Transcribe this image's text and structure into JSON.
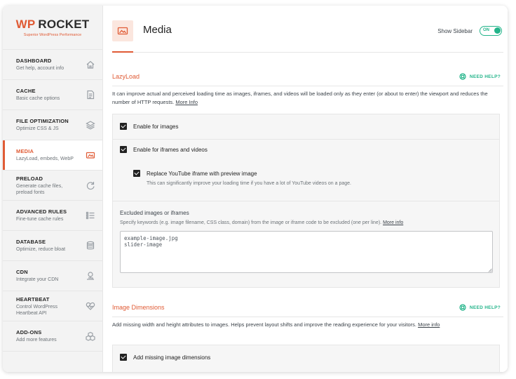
{
  "brand": {
    "wp": "WP",
    "rocket": "ROCKET",
    "tagline": "Superior WordPress Performance"
  },
  "sidebar": {
    "items": [
      {
        "title": "DASHBOARD",
        "sub": "Get help, account info",
        "icon": "home-icon"
      },
      {
        "title": "CACHE",
        "sub": "Basic cache options",
        "icon": "file-icon"
      },
      {
        "title": "FILE OPTIMIZATION",
        "sub": "Optimize CSS & JS",
        "icon": "layers-icon"
      },
      {
        "title": "MEDIA",
        "sub": "LazyLoad, embeds, WebP",
        "icon": "media-icon",
        "active": true
      },
      {
        "title": "PRELOAD",
        "sub": "Generate cache files, preload fonts",
        "icon": "refresh-icon"
      },
      {
        "title": "ADVANCED RULES",
        "sub": "Fine-tune cache rules",
        "icon": "list-icon"
      },
      {
        "title": "DATABASE",
        "sub": "Optimize, reduce bloat",
        "icon": "database-icon"
      },
      {
        "title": "CDN",
        "sub": "Integrate your CDN",
        "icon": "cdn-icon"
      },
      {
        "title": "HEARTBEAT",
        "sub": "Control WordPress Heartbeat API",
        "icon": "heartbeat-icon"
      },
      {
        "title": "ADD-ONS",
        "sub": "Add more features",
        "icon": "addons-icon"
      }
    ]
  },
  "header": {
    "title": "Media",
    "show_sidebar": "Show Sidebar",
    "toggle": "ON"
  },
  "lazyload": {
    "title": "LazyLoad",
    "help": "NEED HELP?",
    "desc": "It can improve actual and perceived loading time as images, iframes, and videos will be loaded only as they enter (or about to enter) the viewport and reduces the number of HTTP requests.",
    "more": "More Info",
    "opt_images": "Enable for images",
    "opt_iframes": "Enable for iframes and videos",
    "opt_youtube": "Replace YouTube iframe with preview image",
    "opt_youtube_desc": "This can significantly improve your loading time if you have a lot of YouTube videos on a page.",
    "excluded_label": "Excluded images or iframes",
    "excluded_desc": "Specify keywords (e.g. image filename, CSS class, domain) from the image or iframe code to be excluded (one per line).",
    "excluded_more": "More info",
    "excluded_value": "example-image.jpg\nslider-image"
  },
  "dimensions": {
    "title": "Image Dimensions",
    "help": "NEED HELP?",
    "desc": "Add missing width and height attributes to images. Helps prevent layout shifts and improve the reading experience for your visitors.",
    "more": "More info",
    "opt_dimensions": "Add missing image dimensions"
  },
  "colors": {
    "accent": "#e05b35",
    "green": "#23b48a"
  }
}
